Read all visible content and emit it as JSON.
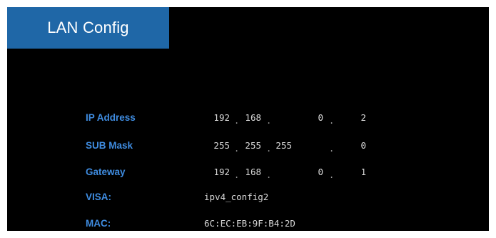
{
  "title": "LAN Config",
  "ip_address": {
    "label": "IP Address",
    "octets": [
      "192",
      "168",
      "0",
      "2"
    ]
  },
  "sub_mask": {
    "label": "SUB Mask",
    "octets": [
      "255",
      "255",
      "255",
      "0"
    ]
  },
  "gateway": {
    "label": "Gateway",
    "octets": [
      "192",
      "168",
      "0",
      "1"
    ]
  },
  "visa": {
    "label": "VISA:",
    "value": "ipv4_config2"
  },
  "mac": {
    "label": "MAC:",
    "value": "6C:EC:EB:9F:B4:2D"
  },
  "separator": ".",
  "colors": {
    "title_bg": "#1f67a7",
    "label": "#3f8ce0",
    "value": "#d8d8d8",
    "background": "#000000"
  }
}
